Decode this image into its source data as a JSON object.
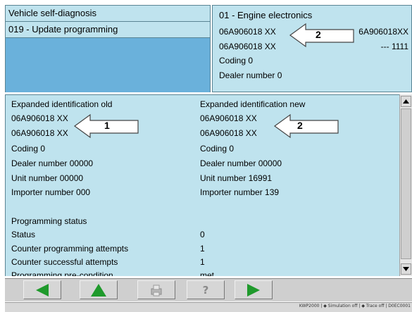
{
  "header": {
    "title": "Vehicle self-diagnosis",
    "function": "019 - Update programming",
    "control_unit": "01 - Engine electronics",
    "part_number_1": "06A906018 XX",
    "part_number_2": "06A906018 XX",
    "part_number_right": "6A906018XX",
    "right_value": "--- 1111",
    "coding": "Coding 0",
    "dealer": "Dealer number 0",
    "callout": "2"
  },
  "identification": {
    "old": {
      "heading": "Expanded identification old",
      "part_1": "06A906018 XX",
      "part_2": "06A906018 XX",
      "coding": "Coding 0",
      "dealer": "Dealer number 00000",
      "unit": "Unit number 00000",
      "importer": "Importer number 000",
      "callout": "1"
    },
    "new": {
      "heading": "Expanded identification new",
      "part_1": "06A906018 XX",
      "part_2": "06A906018 XX",
      "coding": "Coding 0",
      "dealer": "Dealer number 00000",
      "unit": "Unit number 16991",
      "importer": "Importer number 139",
      "callout": "2"
    }
  },
  "programming": {
    "heading": "Programming status",
    "rows": [
      {
        "label": "Status",
        "value": "0"
      },
      {
        "label": "Counter programming attempts",
        "value": "1"
      },
      {
        "label": "Counter successful attempts",
        "value": "1"
      },
      {
        "label": "Programming pre-condition",
        "value": "met"
      }
    ]
  },
  "toolbar": {
    "icons": [
      "left-arrow-icon",
      "up-arrow-icon",
      "print-icon",
      "help-icon",
      "right-arrow-icon"
    ],
    "help_label": "?"
  },
  "status_bar": {
    "text": "KWP2000 | ◆ Simulation off | ◆ Trace off | D0EC0001"
  },
  "colors": {
    "panel": "#bfe3ee",
    "selection": "#6ab1db",
    "nav_arrow": "#1f9a2c"
  }
}
